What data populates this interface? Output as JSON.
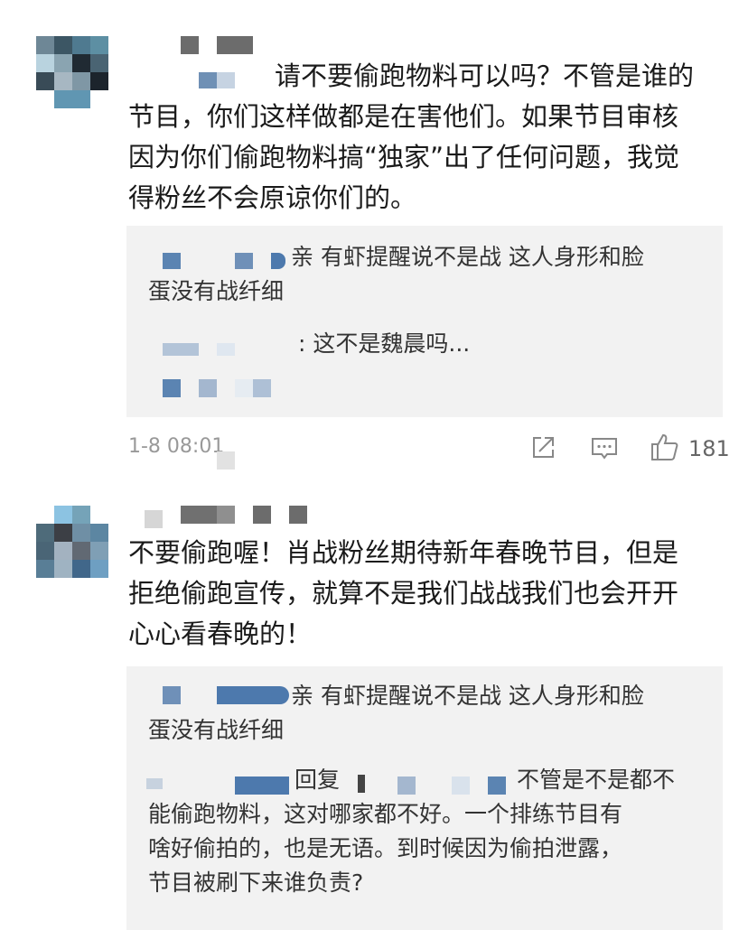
{
  "comments": [
    {
      "text_line1": "请不要偷跑物料可以吗？不管是谁的",
      "text_line2": "节目，你们这样做都是在害他们。如果节目审核",
      "text_line3": "因为你们偷跑物料搞“独家”出了任何问题，我觉",
      "text_line4": "得粉丝不会原谅你们的。",
      "replies": [
        {
          "line1": "亲 有虾提醒说不是战 这人身形和脸",
          "line2": "蛋没有战纤细"
        },
        {
          "line1": ": 这不是魏晨吗..."
        }
      ],
      "timestamp": "1-8 08:01",
      "like_count": "181"
    },
    {
      "text_line1": "不要偷跑喔！肖战粉丝期待新年春晚节目，但是",
      "text_line2": "拒绝偷跑宣传，就算不是我们战战我们也会开开",
      "text_line3": "心心看春晚的！",
      "replies": [
        {
          "line1": "亲 有虾提醒说不是战 这人身形和脸",
          "line2": "蛋没有战纤细"
        },
        {
          "prefix": "回复",
          "line1": "不管是不是都不",
          "line2": "能偷跑物料，这对哪家都不好。一个排练节目有",
          "line3": "啥好偷拍的，也是无语。到时候因为偷拍泄露，",
          "line4": "节目被刷下来谁负责?"
        }
      ]
    }
  ],
  "icons": [
    "share-icon",
    "comment-icon",
    "thumbs-up-icon"
  ]
}
